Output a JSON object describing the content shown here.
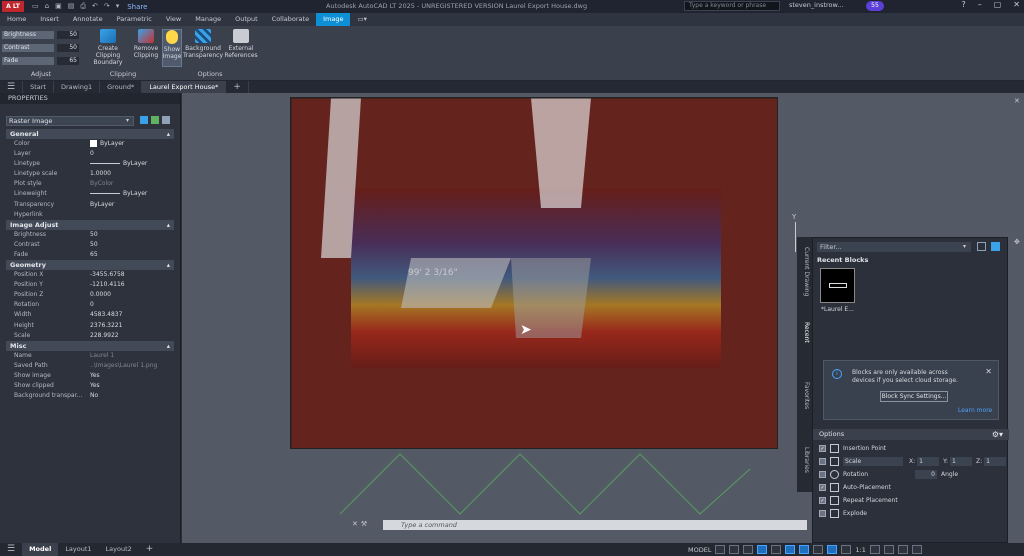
{
  "titlebar": {
    "logo": "A LT",
    "share_label": "Share",
    "title": "Autodesk AutoCAD LT 2025 - UNREGISTERED VERSION    Laurel Export House.dwg",
    "search_placeholder": "Type a keyword or phrase",
    "user": "steven_instrow...",
    "badge": "55"
  },
  "ribbon_tabs": [
    "Home",
    "Insert",
    "Annotate",
    "Parametric",
    "View",
    "Manage",
    "Output",
    "Collaborate",
    "Image"
  ],
  "ribbon_active_tab": "Image",
  "adjust": {
    "brightness_label": "Brightness",
    "brightness_value": "50",
    "contrast_label": "Contrast",
    "contrast_value": "50",
    "fade_label": "Fade",
    "fade_value": "65",
    "panel_label": "Adjust"
  },
  "clipping": {
    "create_label": "Create Clipping Boundary",
    "remove_label": "Remove Clipping",
    "panel_label": "Clipping"
  },
  "options": {
    "show_image_label": "Show Image",
    "bg_transparency_label": "Background Transparency",
    "external_refs_label": "External References",
    "panel_label": "Options"
  },
  "doc_tabs": [
    "Start",
    "Drawing1",
    "Ground*",
    "Laurel Export House*"
  ],
  "doc_active_tab": "Laurel Export House*",
  "properties": {
    "header": "PROPERTIES",
    "object_type": "Raster Image",
    "sections": [
      {
        "title": "General",
        "rows": [
          {
            "k": "Color",
            "v": "ByLayer"
          },
          {
            "k": "Layer",
            "v": "0"
          },
          {
            "k": "Linetype",
            "v": "ByLayer"
          },
          {
            "k": "Linetype scale",
            "v": "1.0000"
          },
          {
            "k": "Plot style",
            "v": "ByColor"
          },
          {
            "k": "Lineweight",
            "v": "ByLayer"
          },
          {
            "k": "Transparency",
            "v": "ByLayer"
          },
          {
            "k": "Hyperlink",
            "v": ""
          }
        ]
      },
      {
        "title": "Image Adjust",
        "rows": [
          {
            "k": "Brightness",
            "v": "50"
          },
          {
            "k": "Contrast",
            "v": "50"
          },
          {
            "k": "Fade",
            "v": "65"
          }
        ]
      },
      {
        "title": "Geometry",
        "rows": [
          {
            "k": "Position X",
            "v": "-3455.6758"
          },
          {
            "k": "Position Y",
            "v": "-1210.4116"
          },
          {
            "k": "Position Z",
            "v": "0.0000"
          },
          {
            "k": "Rotation",
            "v": "0"
          },
          {
            "k": "Width",
            "v": "4583.4837"
          },
          {
            "k": "Height",
            "v": "2376.3221"
          },
          {
            "k": "Scale",
            "v": "228.9922"
          }
        ]
      },
      {
        "title": "Misc",
        "rows": [
          {
            "k": "Name",
            "v": "Laurel 1"
          },
          {
            "k": "Saved Path",
            "v": "..\\Images\\Laurel 1.png"
          },
          {
            "k": "Show image",
            "v": "Yes"
          },
          {
            "k": "Show clipped",
            "v": "Yes"
          },
          {
            "k": "Background transpar...",
            "v": "No"
          }
        ]
      }
    ]
  },
  "viewport": {
    "dimension_label": "99' 2 3/16\"",
    "axis_label": "Y",
    "command_placeholder": "Type a command"
  },
  "blocks_palette": {
    "filter_placeholder": "Filter...",
    "recent_header": "Recent Blocks",
    "thumb_label": "*Laurel E...",
    "notice_text": "Blocks are only available across devices if you select cloud storage.",
    "notice_button": "Block Sync Settings...",
    "notice_link": "Learn more",
    "options_header": "Options",
    "vertical_tabs": [
      "Current Drawing",
      "Recent",
      "Favorites",
      "Libraries"
    ],
    "option_rows": [
      {
        "label": "Insertion Point",
        "checked": true
      },
      {
        "label": "Scale",
        "checked": false
      },
      {
        "label": "Rotation",
        "checked": false
      },
      {
        "label": "Auto-Placement",
        "checked": true
      },
      {
        "label": "Repeat Placement",
        "checked": true
      },
      {
        "label": "Explode",
        "checked": false
      }
    ],
    "scale_x_label": "X:",
    "scale_x": "1",
    "scale_y_label": "Y:",
    "scale_y": "1",
    "scale_z_label": "Z:",
    "scale_z": "1",
    "rotation_value": "0",
    "angle_label": "Angle"
  },
  "status": {
    "tabs": [
      "Model",
      "Layout1",
      "Layout2"
    ],
    "active": "Model",
    "model_label": "MODEL",
    "scale_label": "1:1"
  },
  "colors": {
    "accent": "#0d8fd6",
    "link": "#4aa3ff"
  }
}
